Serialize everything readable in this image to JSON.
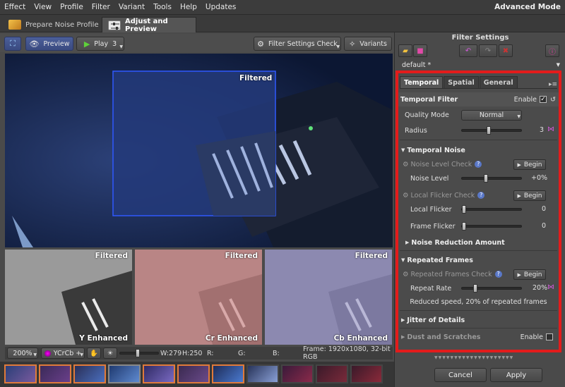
{
  "menu": [
    "Effect",
    "View",
    "Profile",
    "Filter",
    "Variant",
    "Tools",
    "Help",
    "Updates"
  ],
  "mode_label": "Advanced Mode",
  "main_tabs": [
    {
      "label": "Prepare Noise Profile"
    },
    {
      "label": "Adjust and Preview"
    }
  ],
  "toolbar": {
    "preview_label": "Preview",
    "play_label": "Play",
    "play_count": "3",
    "filter_check_label": "Filter Settings Check",
    "variants_label": "Variants"
  },
  "preview": {
    "filtered_label": "Filtered"
  },
  "thumbs": [
    {
      "top": "Filtered",
      "bottom": "Y Enhanced"
    },
    {
      "top": "Filtered",
      "bottom": "Cr Enhanced"
    },
    {
      "top": "Filtered",
      "bottom": "Cb Enhanced"
    }
  ],
  "status": {
    "zoom": "200%",
    "colorspace": "YCrCb +",
    "w": "W:279",
    "h": "H:250",
    "r": "R:",
    "g": "G:",
    "b": "B:",
    "frame": "Frame: 1920x1080, 32-bit RGB"
  },
  "right": {
    "title": "Filter Settings",
    "preset": "default *",
    "subtabs": [
      "Temporal",
      "Spatial",
      "General"
    ],
    "temporal_filter": {
      "label": "Temporal Filter",
      "enable_label": "Enable",
      "enabled": true,
      "quality_mode_label": "Quality Mode",
      "quality_mode_value": "Normal",
      "radius_label": "Radius",
      "radius_value": "3",
      "radius_level": 0.45
    },
    "temporal_noise": {
      "label": "Temporal Noise",
      "noise_check_label": "Noise Level Check",
      "begin_label": "Begin",
      "noise_level_label": "Noise Level",
      "noise_level_value": "+0%",
      "noise_level_level": 0.4,
      "flicker_check_label": "Local Flicker Check",
      "local_flicker_label": "Local Flicker",
      "local_flicker_value": "0",
      "local_flicker_level": 0,
      "frame_flicker_label": "Frame Flicker",
      "frame_flicker_value": "0",
      "frame_flicker_level": 0
    },
    "noise_reduction_label": "Noise Reduction Amount",
    "repeated_frames": {
      "label": "Repeated Frames",
      "check_label": "Repeated Frames Check",
      "begin_label": "Begin",
      "repeat_rate_label": "Repeat Rate",
      "repeat_rate_value": "20%",
      "repeat_rate_level": 0.2,
      "note": "Reduced speed, 20% of repeated frames"
    },
    "jitter_label": "Jitter of Details",
    "dust_label": "Dust and Scratches",
    "dust_enable_label": "Enable"
  },
  "buttons": {
    "cancel": "Cancel",
    "apply": "Apply"
  }
}
